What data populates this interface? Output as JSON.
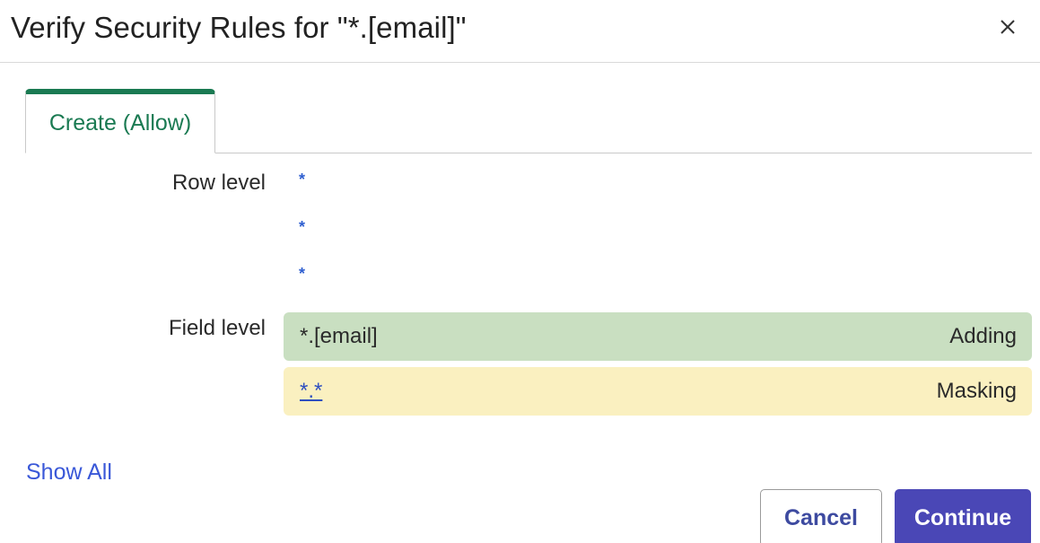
{
  "dialog": {
    "title": "Verify Security Rules for \"*.[email]\"",
    "close_icon": "close-icon"
  },
  "tabs": [
    {
      "label": "Create (Allow)",
      "active": true
    }
  ],
  "row_level": {
    "label": "Row level",
    "entries": [
      "*",
      "*",
      "*"
    ]
  },
  "field_level": {
    "label": "Field level",
    "rows": [
      {
        "name": "*.[email]",
        "status": "Adding",
        "color": "#c9dfc1"
      },
      {
        "name": "*.*",
        "status": "Masking",
        "color": "#faf0c0"
      }
    ]
  },
  "footer": {
    "show_all": "Show All",
    "cancel": "Cancel",
    "continue": "Continue"
  },
  "colors": {
    "accent_green": "#1a7a52",
    "link_blue": "#3a58d8",
    "primary_button": "#4a47b6"
  }
}
